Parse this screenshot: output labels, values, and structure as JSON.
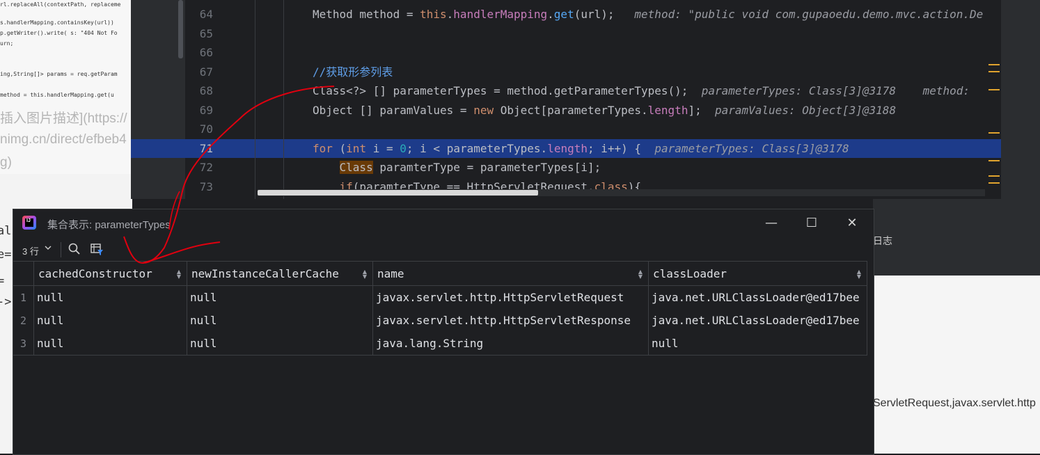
{
  "blog": {
    "mini_code_lines": [
      "rl.replaceAll(contextPath, replaceme",
      "s.handlerMapping.containsKey(url))",
      "p.getWriter().write( s: \"404 Not Fo",
      "urn;",
      "ing,String[]> params = req.getParam",
      "method = this.handlerMapping.get(u"
    ],
    "alt_text_lines": [
      "插入图片描述](https://",
      "nimg.cn/direct/efbeb4",
      "g)"
    ],
    "code_fragments": [
      "alh",
      "e=",
      "= {",
      "->"
    ],
    "right_header": "日志",
    "right_text": "ServletRequest,javax.servlet.http"
  },
  "editor": {
    "lines": [
      {
        "num": "64",
        "code": [
          [
            "",
            "Method method = "
          ],
          [
            "kw",
            "this"
          ],
          [
            "",
            "."
          ],
          [
            "fld",
            "handlerMapping"
          ],
          [
            "",
            "."
          ],
          [
            "fn",
            "get"
          ],
          [
            "",
            "(url);   "
          ],
          [
            "hint",
            "method: \"public void com.gupaoedu.demo.mvc.action.De"
          ]
        ]
      },
      {
        "num": "65",
        "code": []
      },
      {
        "num": "66",
        "code": []
      },
      {
        "num": "67",
        "code": [
          [
            "cmt",
            "//获取形参列表"
          ]
        ]
      },
      {
        "num": "68",
        "code": [
          [
            "",
            "Class<?> [] parameterTypes = method.getParameterTypes();  "
          ],
          [
            "hint",
            "parameterTypes: Class[3]@3178    method:"
          ]
        ]
      },
      {
        "num": "69",
        "code": [
          [
            "",
            "Object [] paramValues = "
          ],
          [
            "kw",
            "new"
          ],
          [
            "",
            " Object[parameterTypes."
          ],
          [
            "fld",
            "length"
          ],
          [
            "",
            "];  "
          ],
          [
            "hint",
            "paramValues: Object[3]@3188"
          ]
        ]
      },
      {
        "num": "70",
        "code": []
      },
      {
        "num": "71",
        "code": [
          [
            "kw",
            "for"
          ],
          [
            "",
            " ("
          ],
          [
            "kw",
            "int"
          ],
          [
            "",
            " i = "
          ],
          [
            "num",
            "0"
          ],
          [
            "",
            "; i < parameterTypes."
          ],
          [
            "fld",
            "length"
          ],
          [
            "",
            "; i++) {  "
          ],
          [
            "hint",
            "parameterTypes: Class[3]@3178"
          ]
        ]
      },
      {
        "num": "72",
        "code": [
          [
            "",
            "    "
          ],
          [
            "classhl",
            "Class"
          ],
          [
            "",
            " paramterType = parameterTypes[i];"
          ]
        ]
      },
      {
        "num": "73",
        "code": [
          [
            "",
            "    "
          ],
          [
            "kw",
            "if"
          ],
          [
            "",
            "(paramterType == HttpServletRequest."
          ],
          [
            "kw",
            "class"
          ],
          [
            "",
            "){"
          ]
        ]
      }
    ],
    "active_line": "71"
  },
  "popup": {
    "title": "集合表示: parameterTypes",
    "rows_label": "3 行",
    "icons": {
      "app": "intellij-app-icon",
      "minimize": "minimize-icon",
      "maximize": "maximize-icon",
      "close": "close-icon",
      "search": "search-icon",
      "filter": "filter-icon",
      "chevron": "chevron-down-icon"
    },
    "columns": [
      "cachedConstructor",
      "newInstanceCallerCache",
      "name",
      "classLoader"
    ],
    "rows": [
      {
        "n": "1",
        "cells": [
          "null",
          "null",
          "javax.servlet.http.HttpServletRequest",
          "java.net.URLClassLoader@ed17bee"
        ]
      },
      {
        "n": "2",
        "cells": [
          "null",
          "null",
          "javax.servlet.http.HttpServletResponse",
          "java.net.URLClassLoader@ed17bee"
        ]
      },
      {
        "n": "3",
        "cells": [
          "null",
          "null",
          "java.lang.String",
          "null"
        ]
      }
    ]
  },
  "colors": {
    "annotation": "#e0000f",
    "active_line": "#1d3b8a",
    "keyword": "#cf8e6d"
  }
}
